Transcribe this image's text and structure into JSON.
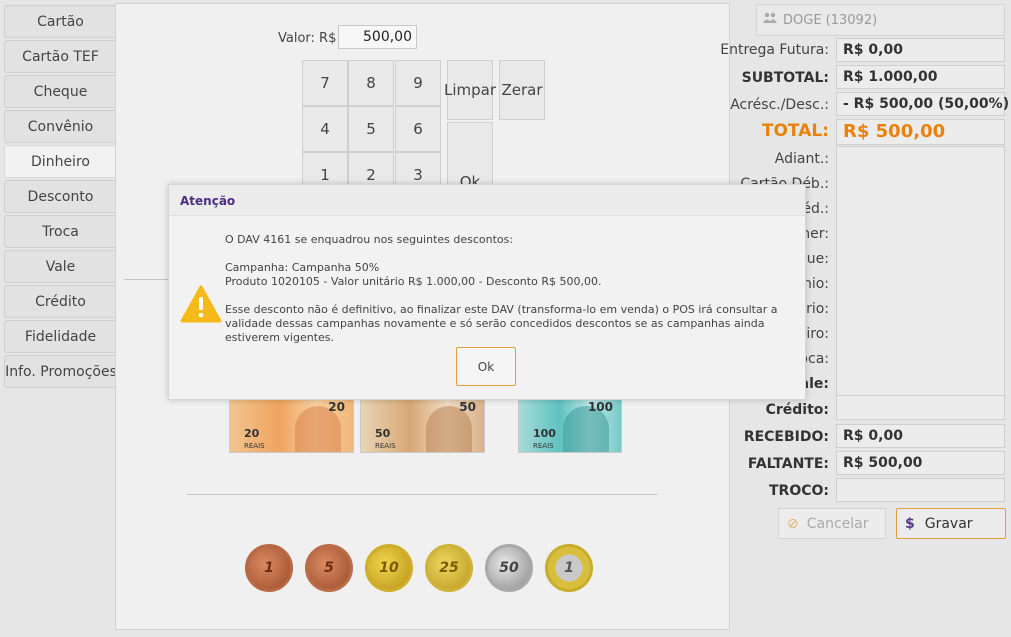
{
  "tabs": [
    {
      "label": "Cartão"
    },
    {
      "label": "Cartão TEF"
    },
    {
      "label": "Cheque"
    },
    {
      "label": "Convênio"
    },
    {
      "label": "Dinheiro"
    },
    {
      "label": "Desconto"
    },
    {
      "label": "Troca"
    },
    {
      "label": "Vale"
    },
    {
      "label": "Crédito"
    },
    {
      "label": "Fidelidade"
    },
    {
      "label": "Info. Promoções"
    }
  ],
  "active_tab": "Dinheiro",
  "payment": {
    "valor_label": "Valor: R$",
    "valor": "500,00",
    "keys": [
      "7",
      "8",
      "9",
      "4",
      "5",
      "6",
      "1",
      "2",
      "3"
    ],
    "limpar": "Limpar",
    "zerar": "Zerar",
    "ok": "Ok"
  },
  "bills": [
    {
      "value": "20",
      "label": "20",
      "reais": "REAIS"
    },
    {
      "value": "50",
      "label": "50",
      "reais": "REAIS"
    },
    {
      "value": "100",
      "label": "100",
      "reais": "REAIS"
    }
  ],
  "coins": [
    "1",
    "5",
    "10",
    "25",
    "50",
    "1"
  ],
  "customer": {
    "name": "DOGE (13092)",
    "icon": "users-icon"
  },
  "summary": {
    "entrega_futura": {
      "label": "Entrega Futura:",
      "value": "R$ 0,00"
    },
    "subtotal": {
      "label": "SUBTOTAL:",
      "value": "R$ 1.000,00"
    },
    "acresc_desc": {
      "label": "Acrésc./Desc.:",
      "value": "- R$ 500,00 (50,00%)"
    },
    "total": {
      "label": "TOTAL:",
      "value": "R$ 500,00"
    },
    "adiant": {
      "label": "Adiant.:"
    },
    "cartao_deb": {
      "label": "Cartão Déb.:"
    },
    "cartao_cred": {
      "label": "Créd.:"
    },
    "voucher": {
      "label": "ucher:"
    },
    "cheque": {
      "label": "que:"
    },
    "convenio": {
      "label": "ênio:"
    },
    "crediario": {
      "label": "ário:"
    },
    "dinheiro": {
      "label": "eiro:"
    },
    "troca": {
      "label": "roca:"
    },
    "vale": {
      "label": "Vale:"
    },
    "credito": {
      "label": "Crédito:"
    },
    "recebido": {
      "label": "RECEBIDO:",
      "value": "R$ 0,00"
    },
    "faltante": {
      "label": "FALTANTE:",
      "value": "R$ 500,00"
    },
    "troco": {
      "label": "TROCO:",
      "value": ""
    }
  },
  "buttons": {
    "cancel": "Cancelar",
    "save": "Gravar"
  },
  "modal": {
    "title": "Atenção",
    "line1": "O DAV 4161 se enquadrou nos seguintes descontos:",
    "line2": "Campanha: Campanha 50%",
    "line3": "Produto 1020105 - Valor unitário R$ 1.000,00 - Desconto R$ 500,00.",
    "line4": "Esse desconto não é definitivo, ao finalizar este DAV (transforma-lo em venda) o POS irá consultar a validade dessas campanhas novamente e só serão concedidos descontos se as campanhas ainda estiverem vigentes.",
    "ok": "Ok"
  },
  "colors": {
    "accent": "#e8820c",
    "brand": "#4b2e83",
    "warning": "#f6b91a"
  }
}
